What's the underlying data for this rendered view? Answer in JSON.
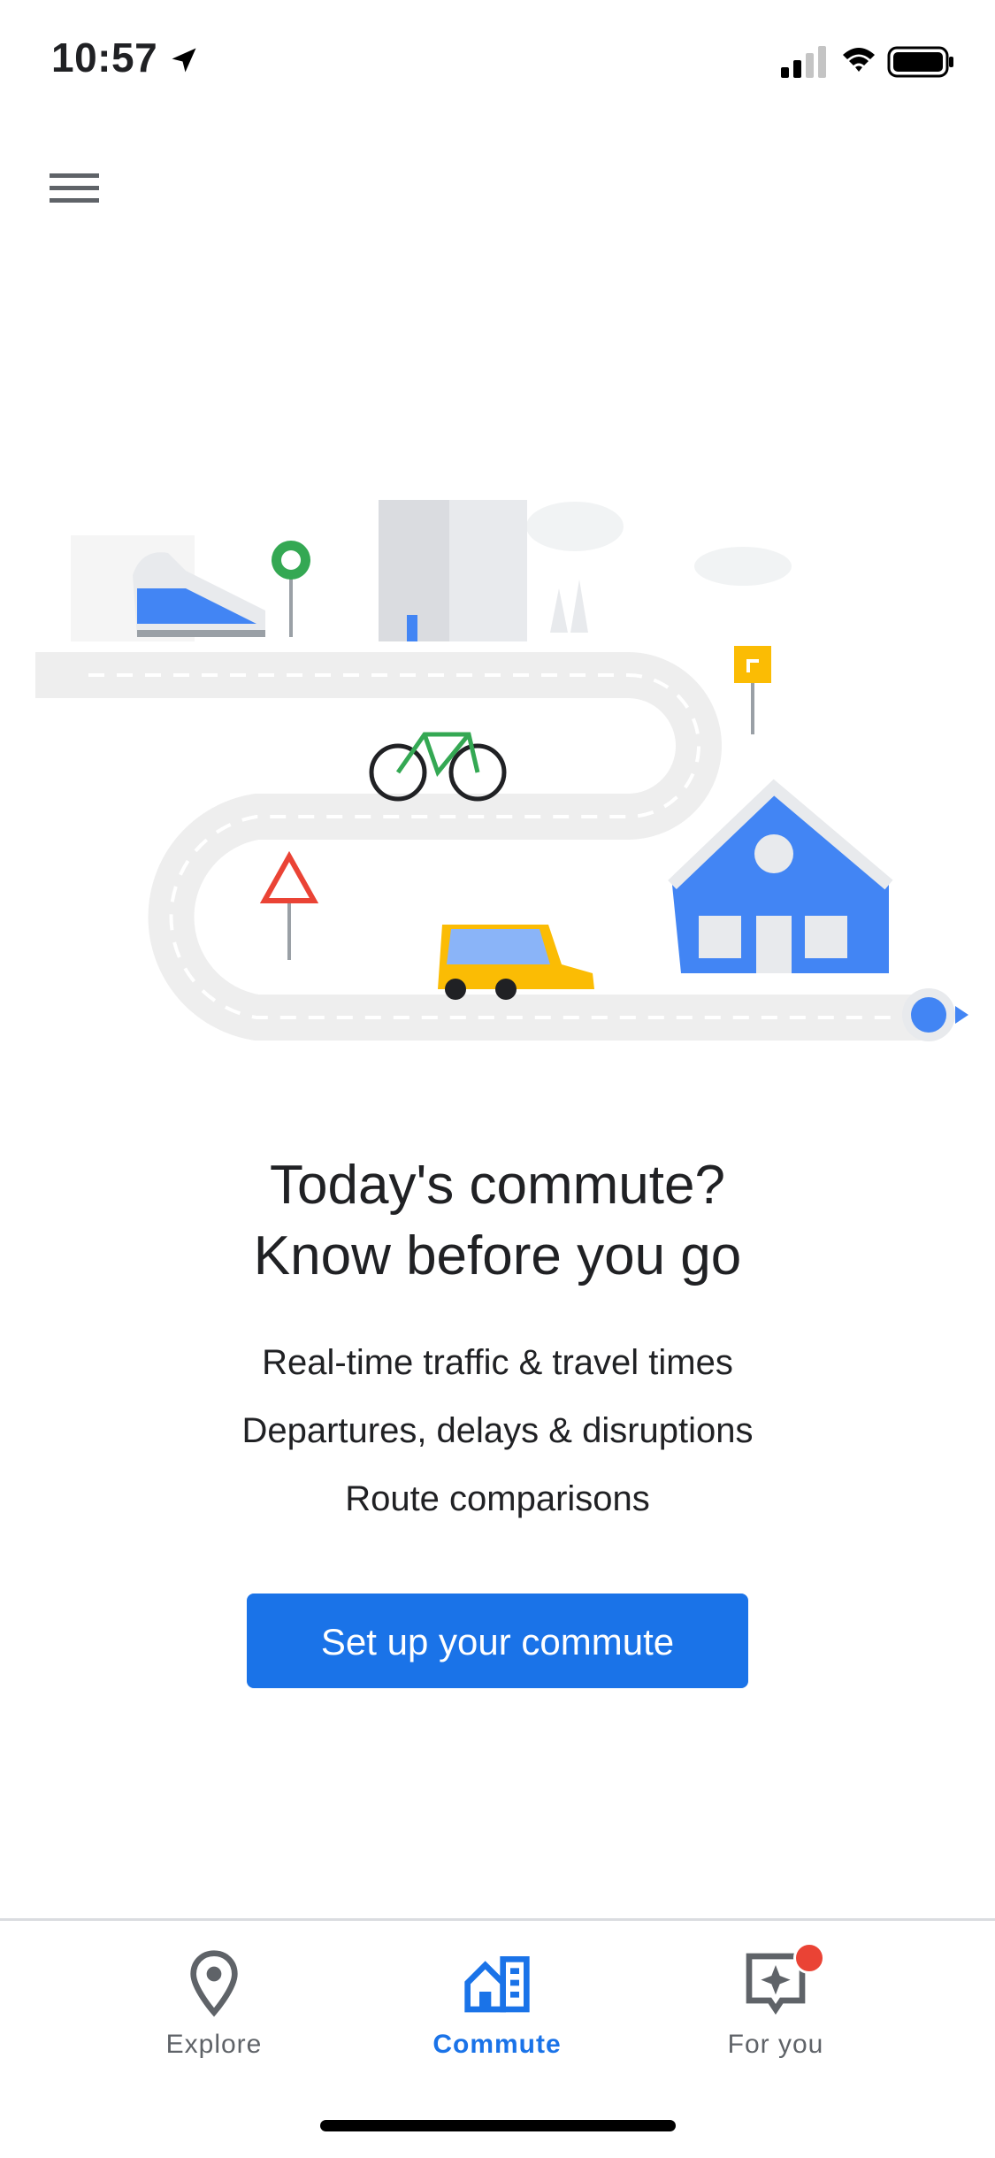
{
  "status": {
    "time": "10:57"
  },
  "headline": {
    "line1": "Today's commute?",
    "line2": "Know before you go"
  },
  "features": [
    "Real-time traffic & travel times",
    "Departures, delays & disruptions",
    "Route comparisons"
  ],
  "cta": {
    "label": "Set up your commute"
  },
  "nav": {
    "items": [
      {
        "label": "Explore",
        "icon": "location-pin-icon",
        "active": false
      },
      {
        "label": "Commute",
        "icon": "commute-home-icon",
        "active": true
      },
      {
        "label": "For you",
        "icon": "sparkle-icon",
        "active": false,
        "badge": true
      }
    ]
  },
  "colors": {
    "accent": "#1a73e8",
    "inactive": "#5f6368",
    "badge": "#ea4335"
  }
}
